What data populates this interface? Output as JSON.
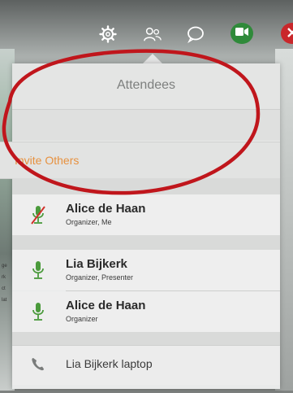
{
  "toolbar": {
    "icons": [
      "gear-icon",
      "people-icon",
      "chat-bubble-icon",
      "video-camera-icon",
      "end-call-icon"
    ],
    "colors": {
      "video": "#2f8a3a",
      "end_call": "#c9272b"
    }
  },
  "panel": {
    "title": "Attendees",
    "invite_label": "Invite Others",
    "invite_color": "#e7913f"
  },
  "attendees": [
    {
      "name": "Alice de Haan",
      "role": "Organizer, Me",
      "mic": "muted"
    },
    {
      "name": "Lia Bijkerk",
      "role": "Organizer, Presenter",
      "mic": "active"
    },
    {
      "name": "Alice de Haan",
      "role": "Organizer",
      "mic": "active"
    }
  ],
  "phone_attendee": {
    "name": "Lia Bijkerk laptop",
    "icon": "phone-icon"
  },
  "annotation": {
    "shape": "ellipse",
    "color": "#c0161c"
  },
  "background_side_text": "ge\nrk\nct\nlat\n\n\n\n\n\n\n14"
}
